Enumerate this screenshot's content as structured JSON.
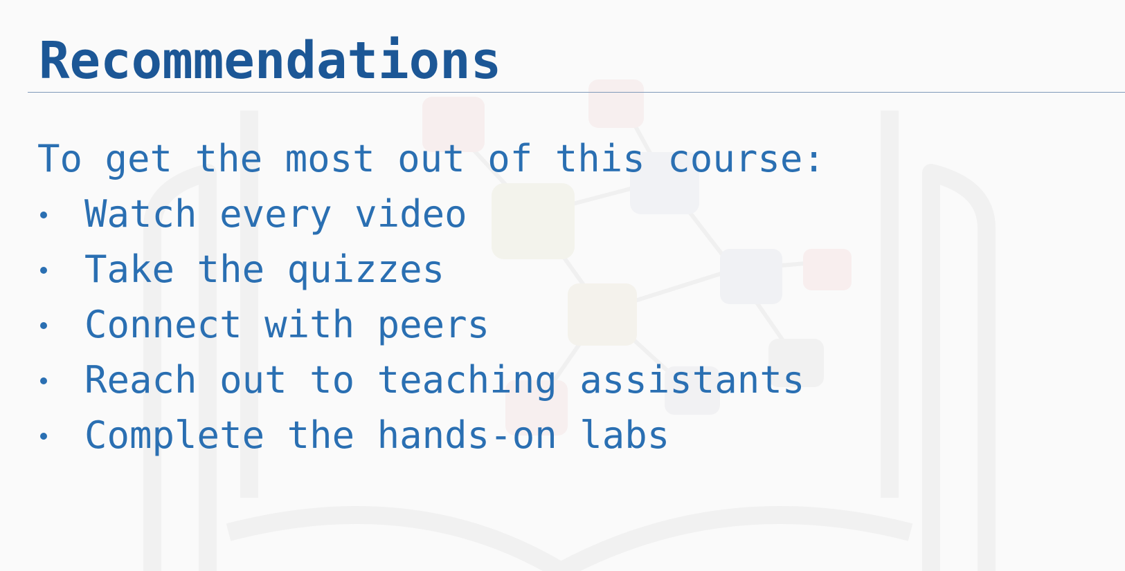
{
  "slide": {
    "title": "Recommendations",
    "intro": "To get the most out of this course:",
    "bullets": [
      {
        "label": "Watch every video"
      },
      {
        "label": "Take the quizzes"
      },
      {
        "label": "Connect with peers"
      },
      {
        "label": "Reach out to teaching assistants"
      },
      {
        "label": "Complete the hands-on labs"
      }
    ]
  },
  "colors": {
    "background": "#fafafa",
    "title": "#1c5796",
    "body_text": "#2a6fb2",
    "rule": "#7f98b8"
  }
}
